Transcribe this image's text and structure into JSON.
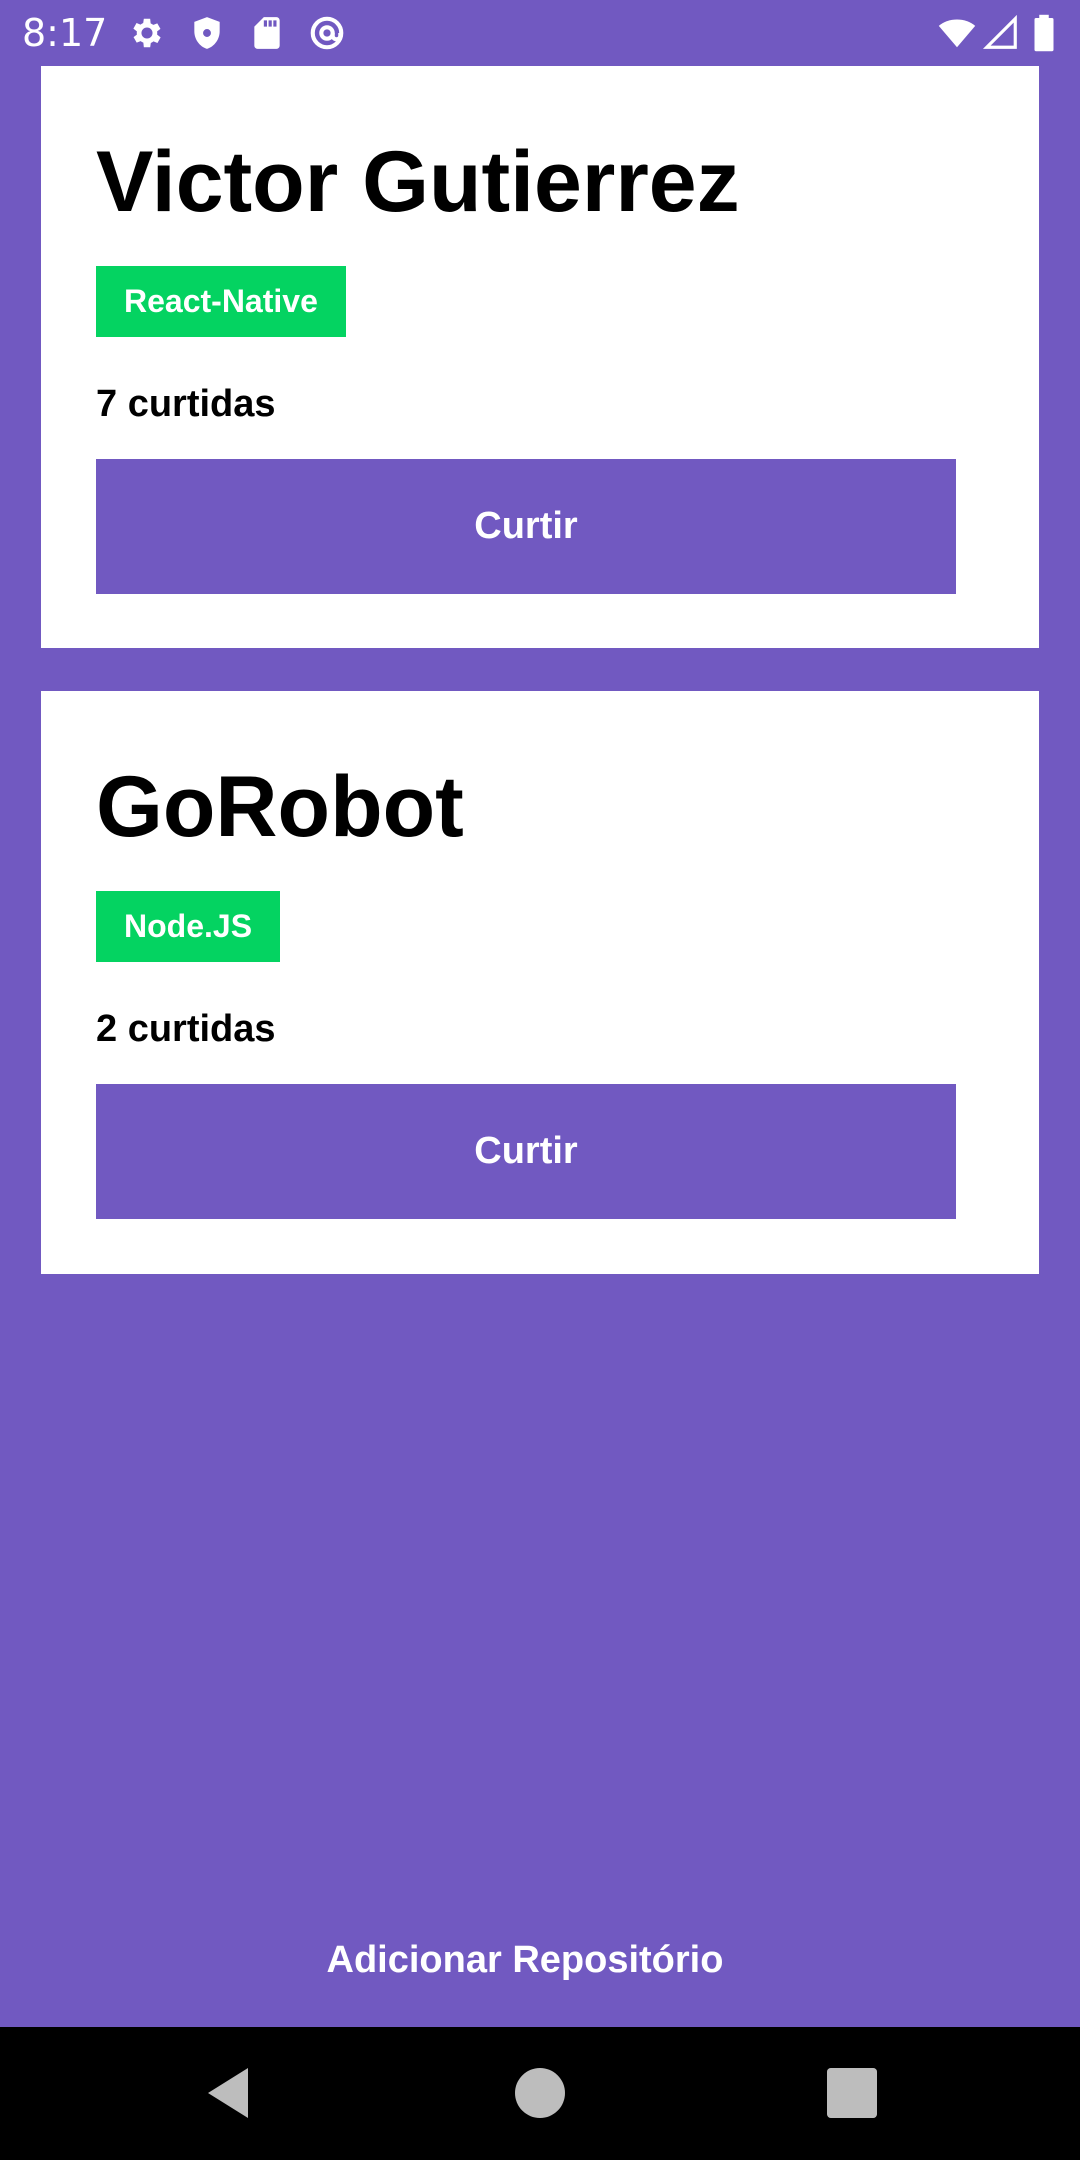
{
  "status_bar": {
    "time": "8:17",
    "left_icons": [
      "gear-icon",
      "shield-icon",
      "sd-card-icon",
      "at-sign-icon"
    ],
    "right_icons": [
      "wifi-icon",
      "cell-signal-icon",
      "battery-icon"
    ]
  },
  "repositories": [
    {
      "title": "Victor Gutierrez",
      "tech": "React-Native",
      "likes": "7 curtidas",
      "like_button_label": "Curtir"
    },
    {
      "title": "GoRobot",
      "tech": "Node.JS",
      "likes": "2 curtidas",
      "like_button_label": "Curtir"
    }
  ],
  "add_repository_label": "Adicionar Repositório",
  "nav_bar": {
    "buttons": [
      "back-icon",
      "home-icon",
      "recents-icon"
    ]
  },
  "colors": {
    "background": "#7159c1",
    "card": "#ffffff",
    "badge": "#04d361",
    "button": "#7159c1",
    "nav_bar": "#000000"
  }
}
